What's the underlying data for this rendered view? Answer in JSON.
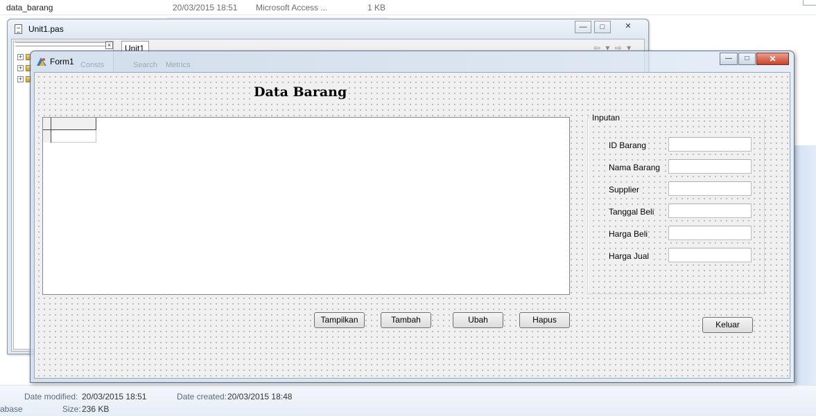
{
  "explorer": {
    "file_row": {
      "name": "data_barang",
      "date": "20/03/2015 18:51",
      "type": "Microsoft Access ...",
      "size": "1 KB"
    },
    "details": {
      "date_modified_label": "Date modified:",
      "date_modified": "20/03/2015 18:51",
      "date_created_label": "Date created:",
      "date_created": "20/03/2015 18:48",
      "type_partial": "abase",
      "size_label": "Size:",
      "size": "236 KB"
    }
  },
  "unit_window": {
    "title": "Unit1.pas",
    "tab": "Unit1",
    "close_glyph": "×",
    "expand_glyph": "+",
    "nav": "⇦ ▾ ⇨ ▾",
    "caption": {
      "minimize": "—",
      "maximize": "□",
      "close": "✕"
    }
  },
  "form": {
    "title": "Form1",
    "ghost_texts": [
      "Consts",
      "Search",
      "Metrics"
    ],
    "caption": {
      "minimize": "—",
      "maximize": "□",
      "close": "✕"
    },
    "heading": "Data Barang",
    "group": {
      "caption": "Inputan",
      "fields": [
        {
          "label": "ID Barang",
          "value": ""
        },
        {
          "label": "Nama Barang",
          "value": ""
        },
        {
          "label": "Supplier",
          "value": ""
        },
        {
          "label": "Tanggal Beli",
          "value": ""
        },
        {
          "label": "Harga Beli",
          "value": ""
        },
        {
          "label": "Harga Jual",
          "value": ""
        }
      ]
    },
    "buttons": {
      "tampilkan": "Tampilkan",
      "tambah": "Tambah",
      "ubah": "Ubah",
      "hapus": "Hapus",
      "keluar": "Keluar"
    }
  }
}
